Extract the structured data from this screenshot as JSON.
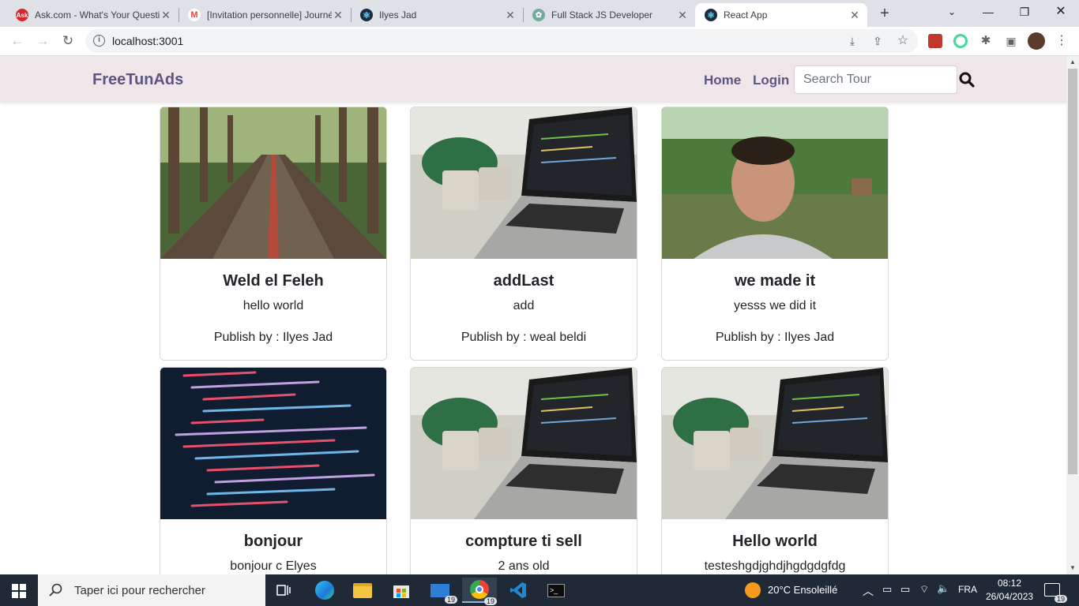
{
  "browser": {
    "tabs": [
      {
        "label": "Ask.com - What's Your Question?",
        "favicon": "ask-icon",
        "color": "#d7262c",
        "glyph": "Ask"
      },
      {
        "label": "[Invitation personnelle] Journée",
        "favicon": "gmail-icon",
        "color": "#ea4335",
        "glyph": "M"
      },
      {
        "label": "Ilyes Jad",
        "favicon": "react-icon",
        "color": "#1b2a3d",
        "glyph": "⚛"
      },
      {
        "label": "Full Stack JS Developer",
        "favicon": "chatgpt-icon",
        "color": "#74aa9c",
        "glyph": "✿"
      },
      {
        "label": "React App",
        "favicon": "react-icon",
        "color": "#1b2a3d",
        "glyph": "⚛"
      }
    ],
    "url": "localhost:3001"
  },
  "navbar": {
    "brand": "FreeTunAds",
    "links": [
      "Home",
      "Login"
    ],
    "search_placeholder": "Search Tour"
  },
  "cards": [
    {
      "title": "Weld el Feleh",
      "description": "hello world",
      "publisher": "Publish by : Ilyes Jad",
      "image": "road"
    },
    {
      "title": "addLast",
      "description": "add",
      "publisher": "Publish by : weal beldi",
      "image": "laptop"
    },
    {
      "title": "we made it",
      "description": "yesss we did it",
      "publisher": "Publish by : Ilyes Jad",
      "image": "person"
    },
    {
      "title": "bonjour",
      "description": "bonjour c Elyes",
      "publisher": "",
      "image": "code"
    },
    {
      "title": "compture ti sell",
      "description": "2 ans old",
      "publisher": "",
      "image": "laptop"
    },
    {
      "title": "Hello world",
      "description": "testeshgdjghdjhgdgdgfdg",
      "publisher": "",
      "image": "laptop"
    }
  ],
  "taskbar": {
    "search_placeholder": "Taper ici pour rechercher",
    "weather": "20°C  Ensoleillé",
    "lang": "FRA",
    "time": "08:12",
    "date": "26/04/2023",
    "mail_badge": "19",
    "chrome_badge": "19",
    "notif_badge": "19"
  }
}
